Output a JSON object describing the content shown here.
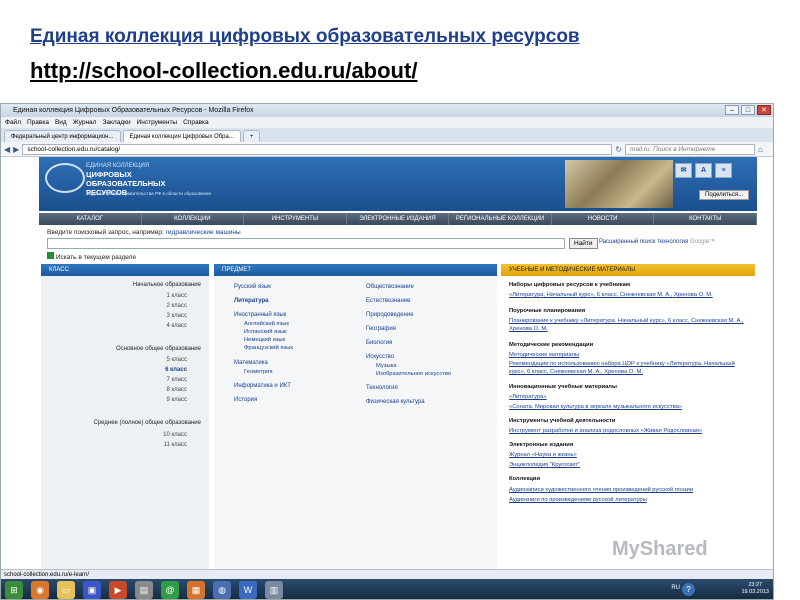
{
  "slide": {
    "title": "Единая коллекция цифровых образовательных ресурсов",
    "url": "http://school-collection.edu.ru/about/"
  },
  "browser": {
    "window_title": "Единая коллекция Цифровых Образовательных Ресурсов - Mozilla Firefox",
    "menu": [
      "Файл",
      "Правка",
      "Вид",
      "Журнал",
      "Закладки",
      "Инструменты",
      "Справка"
    ],
    "tabs": [
      "Федеральный центр информацион...",
      "Единая коллекция Цифровых Обра..."
    ],
    "address": "school-collection.edu.ru/catalog/",
    "search_placeholder": "mail.ru: Поиск в Интернете",
    "status_url": "school-collection.edu.ru/e-learn/"
  },
  "site": {
    "logo_small": "ЕДИНАЯ КОЛЛЕКЦИЯ",
    "logo_big": "ЦИФРОВЫХ ОБРАЗОВАТЕЛЬНЫХ РЕСУРСОВ",
    "logo_sub": "Лауреат Премии Правительства РФ в области образования",
    "share": "Поделиться...",
    "nav": [
      "КАТАЛОГ",
      "КОЛЛЕКЦИИ",
      "ИНСТРУМЕНТЫ",
      "ЭЛЕКТРОННЫЕ ИЗДАНИЯ",
      "РЕГИОНАЛЬНЫЕ КОЛЛЕКЦИИ",
      "НОВОСТИ",
      "КОНТАКТЫ"
    ],
    "query_label": "Введите поисковый запрос, например:",
    "query_example": "гидравлические машины",
    "search_button": "Найти",
    "advanced_search": "Расширенный поиск",
    "technology": "технология",
    "google": "Google™",
    "search_in_section": "Искать в текущем разделе",
    "col_class": "КЛАСС",
    "col_subject": "ПРЕДМЕТ",
    "col_materials": "УЧЕБНЫЕ И МЕТОДИЧЕСКИЕ МАТЕРИАЛЫ",
    "levels": [
      {
        "label": "Начальное образование",
        "grades": [
          "1 класс",
          "2 класс",
          "3 класс",
          "4 класс"
        ]
      },
      {
        "label": "Основное общее образование",
        "grades": [
          "5 класс",
          "6 класс",
          "7 класс",
          "8 класс",
          "9 класс"
        ]
      },
      {
        "label": "Среднее (полное) общее образование",
        "grades": [
          "10 класс",
          "11 класс"
        ]
      }
    ],
    "subjects_left": [
      "Русский язык",
      "Литература",
      "Иностранный язык",
      "Английский язык",
      "Испанский язык",
      "Немецкий язык",
      "Французский язык",
      "Математика",
      "Геометрия",
      "Информатика и ИКТ",
      "История"
    ],
    "subjects_right": [
      "Обществознание",
      "Естествознание",
      "Природоведение",
      "География",
      "Биология",
      "Искусство",
      "Музыка",
      "Изобразительное искусство",
      "Технология",
      "Физическая культура"
    ],
    "materials": [
      {
        "h": "Наборы цифровых ресурсов к учебникам",
        "links": [
          "«Литература, Начальный курс», 6 класс, Снежневская М. А., Хренова О. М."
        ]
      },
      {
        "h": "Поурочные планирования",
        "links": [
          "Планирование к учебнику «Литература. Начальный курс», 6 класс, Снежневская М. А., Хренова О. М."
        ]
      },
      {
        "h": "Методические рекомендации",
        "links": [
          "Методические материалы",
          "Рекомендации по использованию набора ЦОР к учебнику «Литература. Начальный курс», 6 класс, Снежневская М. А., Хренова О. М."
        ]
      },
      {
        "h": "Инновационные учебные материалы",
        "links": [
          "«Литература»",
          "«Соната. Мировая культура в зеркале музыкального искусства»"
        ]
      },
      {
        "h": "Инструменты учебной деятельности",
        "links": [
          "Инструмент разработки и анализа родословных «Живая Родословная»"
        ]
      },
      {
        "h": "Электронные издания",
        "links": [
          "Журнал «Наука и жизнь»",
          "Энциклопедия \"Кругосвет\""
        ]
      },
      {
        "h": "Коллекции",
        "links": [
          "Аудиозаписи художественного чтения произведений русской поэзии",
          "Аудиокниги по произведениям русской литературы"
        ]
      }
    ]
  },
  "taskbar": {
    "lang": "RU",
    "time": "23:27",
    "date": "19.03.2013"
  },
  "watermark": "MyShared"
}
